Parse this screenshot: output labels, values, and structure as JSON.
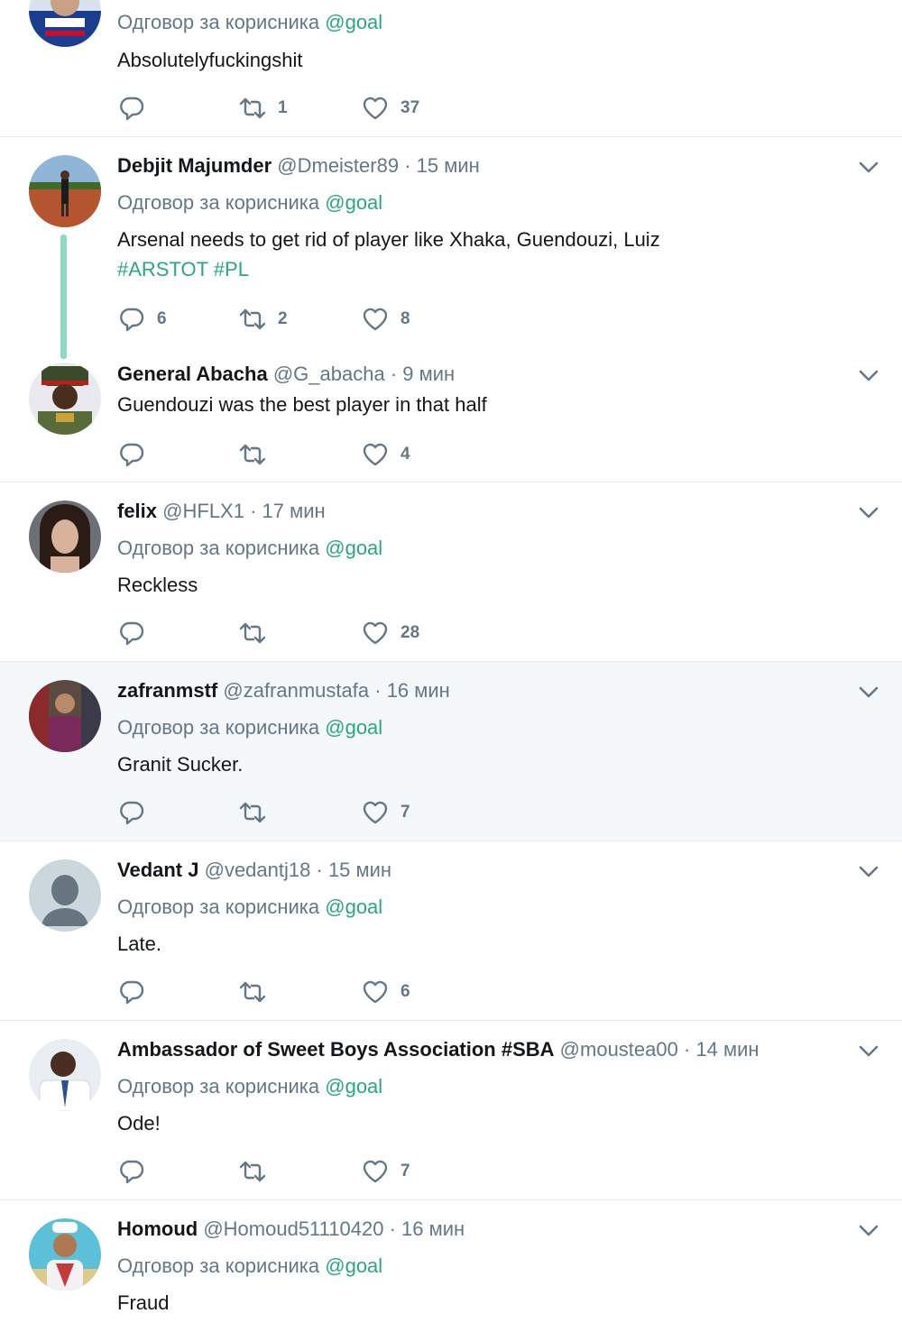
{
  "reply_prefix": "Одговор за корисника",
  "reply_mention": "@goal",
  "dot": "·",
  "tweets": [
    {
      "name": "",
      "handle": "",
      "time": "",
      "text": "Absolutelyfuckingshit",
      "counts": {
        "reply": "",
        "retweet": "1",
        "like": "37"
      }
    },
    {
      "name": "Debjit Majumder",
      "handle": "@Dmeister89",
      "time": "15 мин",
      "text": "Arsenal needs to get rid of player like Xhaka, Guendouzi, Luiz",
      "tags": [
        "#ARSTOT",
        "#PL"
      ],
      "counts": {
        "reply": "6",
        "retweet": "2",
        "like": "8"
      }
    },
    {
      "name": "General Abacha",
      "handle": "@G_abacha",
      "time": "9 мин",
      "text": "Guendouzi was the best player in that half",
      "counts": {
        "reply": "",
        "retweet": "",
        "like": "4"
      }
    },
    {
      "name": "felix",
      "handle": "@HFLX1",
      "time": "17 мин",
      "text": "Reckless",
      "counts": {
        "reply": "",
        "retweet": "",
        "like": "28"
      }
    },
    {
      "name": "zafranmstf",
      "handle": "@zafranmustafa",
      "time": "16 мин",
      "text": "Granit Sucker.",
      "counts": {
        "reply": "",
        "retweet": "",
        "like": "7"
      }
    },
    {
      "name": "Vedant J",
      "handle": "@vedantj18",
      "time": "15 мин",
      "text": "Late.",
      "counts": {
        "reply": "",
        "retweet": "",
        "like": "6"
      }
    },
    {
      "name": "Ambassador of Sweet Boys Association #SBA",
      "handle": "@moustea00",
      "time": "14 мин",
      "text": "Ode!",
      "counts": {
        "reply": "",
        "retweet": "",
        "like": "7"
      }
    },
    {
      "name": "Homoud",
      "handle": "@Homoud51110420",
      "time": "16 мин",
      "text": "Fraud",
      "counts": {
        "reply": "",
        "retweet": "",
        "like": ""
      }
    }
  ],
  "icons": {
    "reply": "reply-icon",
    "retweet": "retweet-icon",
    "like": "heart-icon",
    "menu": "chevron-down-icon"
  },
  "colors": {
    "mention": "#2aa87c",
    "thread_line": "#8fd9c3",
    "secondary": "#657786",
    "highlight_bg": "#f5f8fa"
  }
}
